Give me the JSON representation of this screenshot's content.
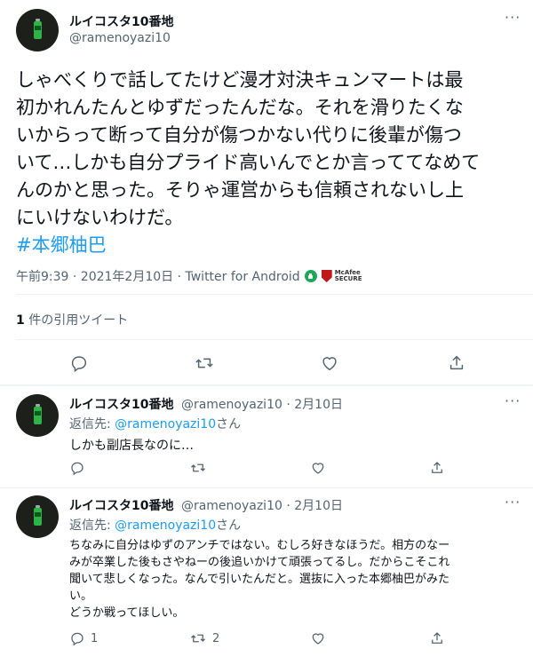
{
  "main_tweet": {
    "author_name": "ルイコスタ10番地",
    "author_handle": "@ramenoyazi10",
    "more_icon": "more-icon",
    "lines": [
      "しゃべくりで話してたけど漫才対決キュンマートは最",
      "初かれんたんとゆずだったんだな。それを滑りたくな",
      "いからって断って自分が傷つかない代りに後輩が傷つ",
      "いて…しかも自分プライド高いんでとか言っててなめて",
      "んのかと思った。そりゃ運営からも信頼されないし上",
      "にいけないわけだ。"
    ],
    "hashtag": "#本郷柚巴",
    "timestamp": "午前9:39 · 2021年2月10日 · Twitter for Android",
    "mcafee_line1": "McAfee",
    "mcafee_line2": "SECURE",
    "quote_count": "1",
    "quote_label": " 件の引用ツイート",
    "colors": {
      "link": "#1d9bf0",
      "text": "#0f1419",
      "muted": "#536471",
      "divider": "#eff3f4"
    }
  },
  "replies": [
    {
      "author_name": "ルイコスタ10番地",
      "author_handle": "@ramenoyazi10",
      "dot": "·",
      "date": "2月10日",
      "reply_to_prefix": "返信先: ",
      "reply_to_handle": "@ramenoyazi10",
      "reply_to_suffix": "さん",
      "body_lines": [
        "しかも副店長なのに…"
      ],
      "reply_count": "",
      "retweet_count": "",
      "like_count": ""
    },
    {
      "author_name": "ルイコスタ10番地",
      "author_handle": "@ramenoyazi10",
      "dot": "·",
      "date": "2月10日",
      "reply_to_prefix": "返信先: ",
      "reply_to_handle": "@ramenoyazi10",
      "reply_to_suffix": "さん",
      "body_lines": [
        "ちなみに自分はゆずのアンチではない。むしろ好きなほうだ。相方のなー",
        "みが卒業した後もさやねーの後追いかけて頑張ってるし。だからこそこれ",
        "聞いて悲しくなった。なんで引いたんだと。選抜に入った本郷柚巴がみた",
        "い。",
        "どうか戦ってほしい。"
      ],
      "reply_count": "1",
      "retweet_count": "2",
      "like_count": ""
    }
  ]
}
